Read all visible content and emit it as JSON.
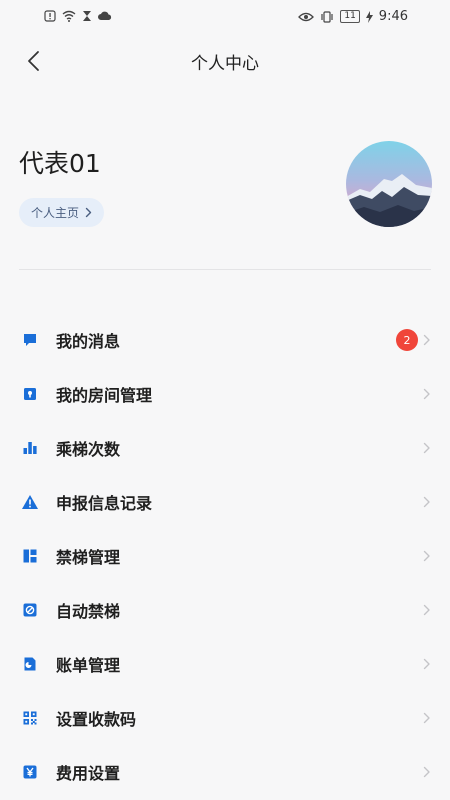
{
  "status_bar": {
    "time": "9:46",
    "battery": "11",
    "icons_left": [
      "alert-icon",
      "wifi-icon",
      "hourglass-icon",
      "cloud-icon"
    ],
    "icons_right": [
      "eye-icon",
      "vibrate-icon",
      "battery-icon",
      "charging-icon"
    ]
  },
  "header": {
    "title": "个人中心",
    "back_icon": "chevron-left-icon"
  },
  "profile": {
    "name": "代表01",
    "home_link_label": "个人主页",
    "avatar": "mountain-landscape-avatar"
  },
  "menu": {
    "items": [
      {
        "label": "我的消息",
        "icon": "message-icon",
        "badge": "2"
      },
      {
        "label": "我的房间管理",
        "icon": "lock-icon"
      },
      {
        "label": "乘梯次数",
        "icon": "bar-chart-icon"
      },
      {
        "label": "申报信息记录",
        "icon": "warning-icon"
      },
      {
        "label": "禁梯管理",
        "icon": "layout-icon"
      },
      {
        "label": "自动禁梯",
        "icon": "ban-icon"
      },
      {
        "label": "账单管理",
        "icon": "bill-icon"
      },
      {
        "label": "设置收款码",
        "icon": "qr-code-icon"
      },
      {
        "label": "费用设置",
        "icon": "yen-icon"
      }
    ]
  },
  "colors": {
    "accent": "#1a6ed8",
    "badge": "#f0453a",
    "background": "#f7f7f8",
    "home_link_bg": "#e6eef9"
  }
}
